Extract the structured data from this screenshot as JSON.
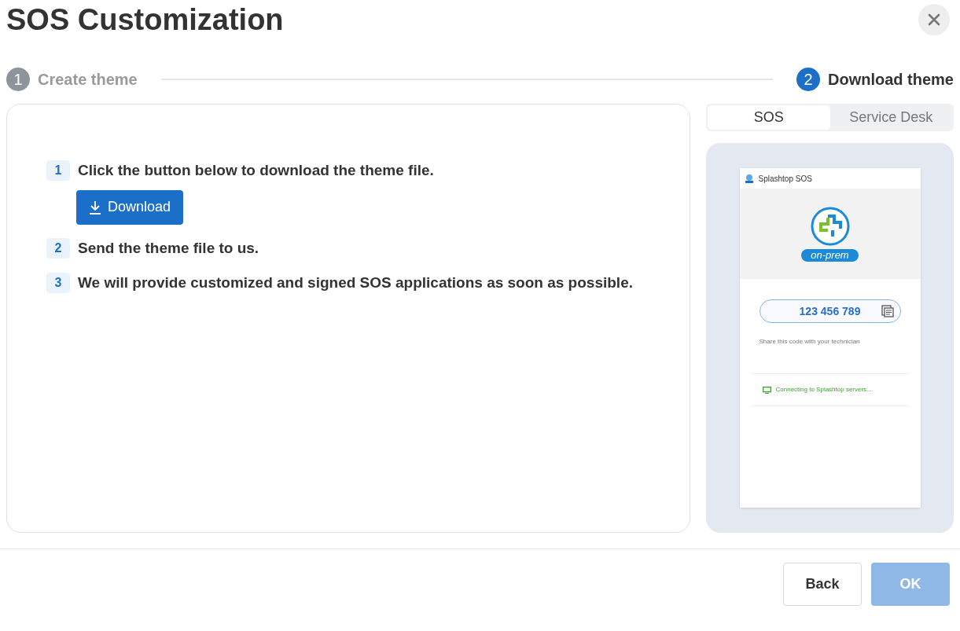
{
  "title": "SOS Customization",
  "steps": [
    {
      "number": "1",
      "label": "Create theme",
      "selected": false
    },
    {
      "number": "2",
      "label": "Download theme",
      "selected": true
    }
  ],
  "instructions": [
    {
      "number": "1",
      "text": "Click the button below to download the theme file.",
      "button": "Download"
    },
    {
      "number": "2",
      "text": "Send the theme file to us."
    },
    {
      "number": "3",
      "text": "We will provide customized and signed SOS applications as soon as possible."
    }
  ],
  "tabs": [
    {
      "label": "SOS",
      "selected": true
    },
    {
      "label": "Service Desk",
      "selected": false
    }
  ],
  "preview": {
    "app_title": "Splashtop SOS",
    "badge": "on-prem",
    "code": "123 456 789",
    "hint": "Share this code with your technician",
    "status": "Connecting to Splashtop servers..."
  },
  "footer": {
    "buttons": [
      {
        "label": "Back",
        "kind": "secondary",
        "disabled": false
      },
      {
        "label": "OK",
        "kind": "primary",
        "disabled": true
      }
    ]
  }
}
